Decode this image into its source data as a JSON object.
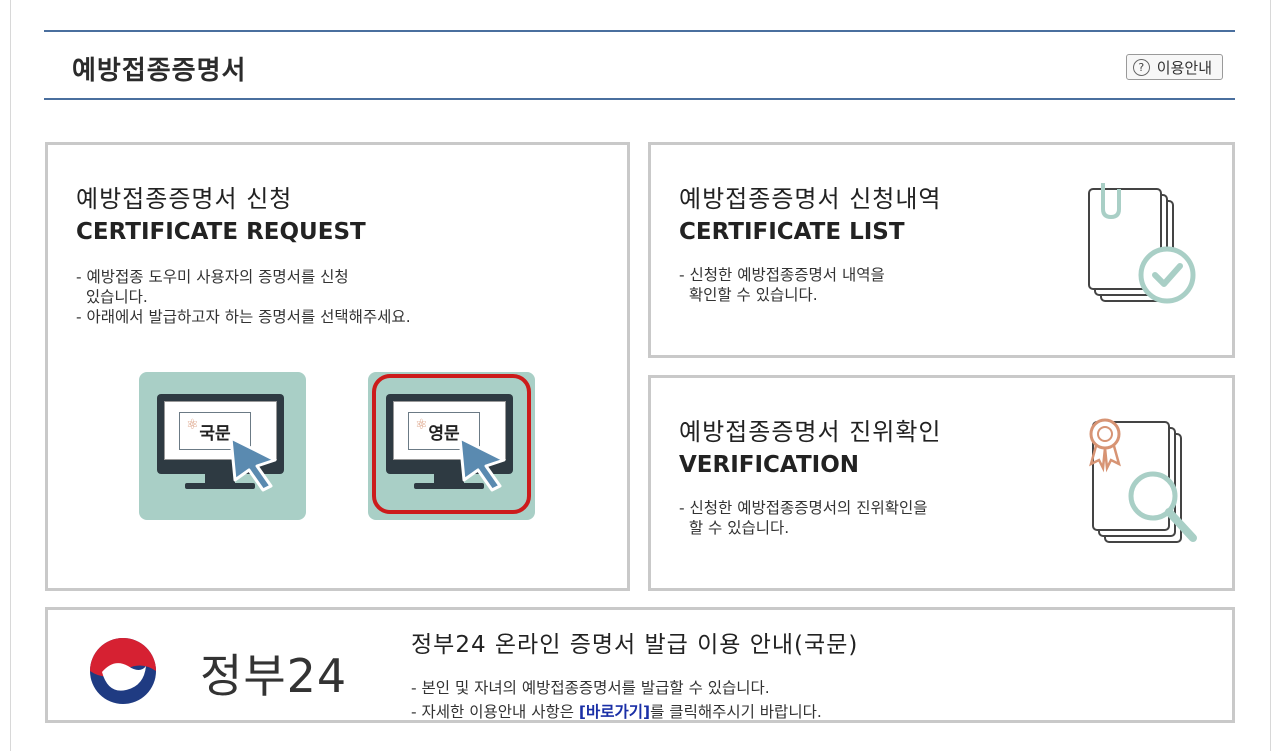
{
  "header": {
    "title": "예방접종증명서",
    "guide_icon": "?",
    "guide_label": "이용안내"
  },
  "request": {
    "title_ko": "예방접종증명서 신청",
    "title_en": "CERTIFICATE REQUEST",
    "desc_1": "- 예방접종 도우미 사용자의 증명서를 신청\n  있습니다.",
    "desc_2": "- 아래에서 발급하고자 하는 증명서를 선택해주세요.",
    "tile_korean": "국문",
    "tile_english": "영문",
    "selected_tile": "영문"
  },
  "list": {
    "title_ko": "예방접종증명서 신청내역",
    "title_en": "CERTIFICATE LIST",
    "desc": "- 신청한 예방접종증명서 내역을\n  확인할 수 있습니다."
  },
  "verify": {
    "title_ko": "예방접종증명서 진위확인",
    "title_en": "VERIFICATION",
    "desc": "- 신청한 예방접종증명서의 진위확인을\n  할 수 있습니다."
  },
  "gov24": {
    "logo_text": "정부24",
    "title": "정부24 온라인 증명서 발급 이용 안내(국문)",
    "desc_1": "- 본인 및 자녀의 예방접종증명서를 발급할 수 있습니다.",
    "desc_2_pre": "- 자세한 이용안내 사항은 ",
    "desc_2_link": "[바로가기]",
    "desc_2_post": "를 클릭해주시기 바랍니다."
  },
  "colors": {
    "header_line": "#4a6f9e",
    "tile_bg": "#a9cfc6",
    "selected_border": "#cc1b1b",
    "link": "#1a2fa6",
    "icon_teal": "#a9cfc6"
  }
}
